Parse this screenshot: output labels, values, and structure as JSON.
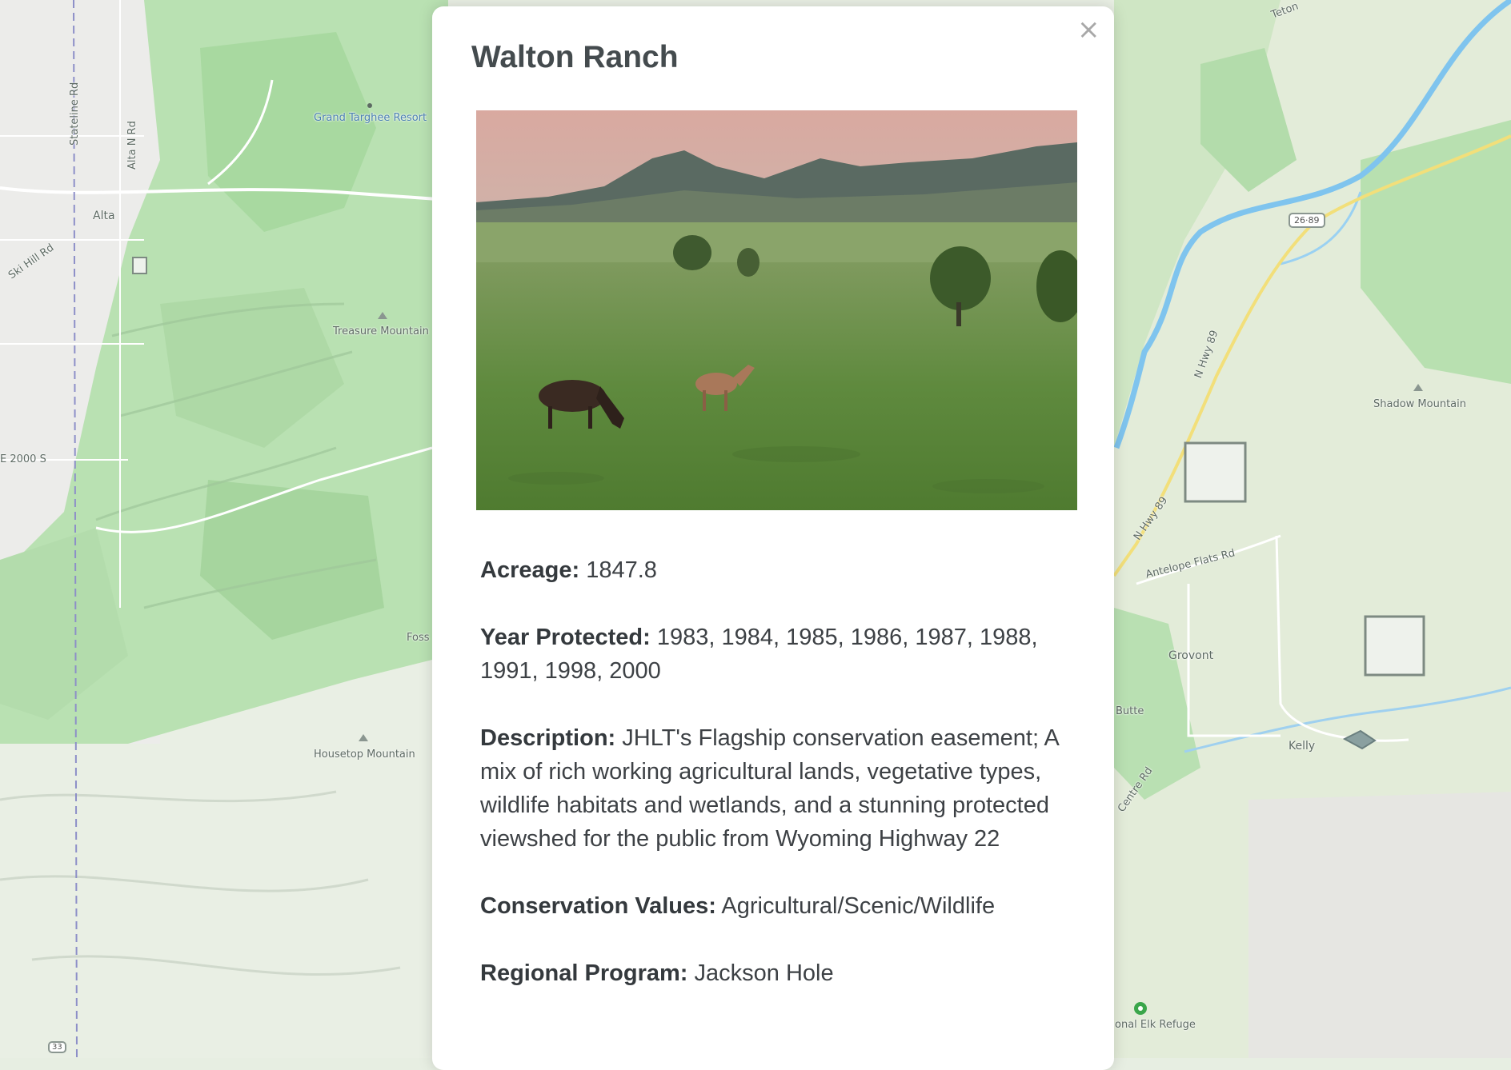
{
  "map": {
    "labels": {
      "grand_targhee": "Grand Targhee Resort",
      "stateline": "Stateline Rd",
      "alta_n": "Alta N Rd",
      "alta": "Alta",
      "ski_hill": "Ski Hill Rd",
      "treasure": "Treasure Mountain",
      "e2000": "E 2000 S",
      "foss": "Foss",
      "housetop": "Housetop Mountain",
      "teton": "Teton",
      "hwy_shield": "26·89",
      "n_hwy_89_top": "N Hwy 89",
      "n_hwy_89_bottom": "N Hwy 89",
      "shadow": "Shadow Mountain",
      "antelope": "Antelope Flats Rd",
      "grovont": "Grovont",
      "butte": "Butte",
      "kelly": "Kelly",
      "centre": "Centre Rd",
      "elk": "onal Elk Refuge",
      "shield_33": "33"
    }
  },
  "modal": {
    "close": "×",
    "title": "Walton Ranch",
    "photo_description": "Horses grazing in a green pasture with mountains at dusk",
    "details": [
      {
        "label": "Acreage:",
        "value": "1847.8"
      },
      {
        "label": "Year Protected:",
        "value": "1983, 1984, 1985, 1986, 1987, 1988, 1991, 1998, 2000"
      },
      {
        "label": "Description:",
        "value": "JHLT's Flagship conservation easement; A mix of rich working agricultural lands, vegetative types, wildlife habitats and wetlands, and a stunning protected viewshed for the public from Wyoming Highway 22"
      },
      {
        "label": "Conservation Values:",
        "value": "Agricultural/Scenic/Wildlife"
      },
      {
        "label": "Regional Program:",
        "value": "Jackson Hole"
      }
    ]
  }
}
